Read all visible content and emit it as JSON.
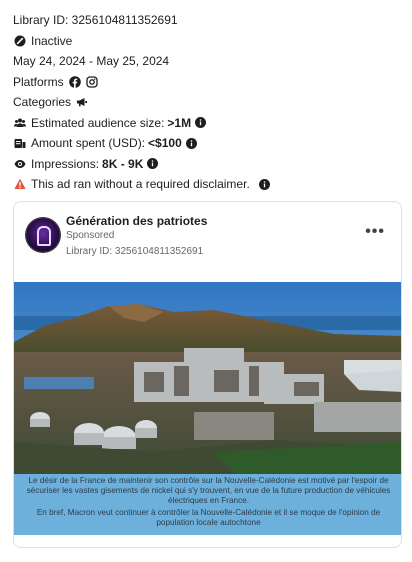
{
  "ad_meta": {
    "library_id": "Library ID: 3256104811352691",
    "status": "Inactive",
    "date_range": "May 24, 2024 - May 25, 2024",
    "platforms_label": "Platforms",
    "platform_icons": [
      "facebook-icon",
      "instagram-icon"
    ],
    "categories_label": "Categories",
    "category_icon": "megaphone-icon",
    "audience_label": "Estimated audience size:",
    "audience_value": ">1M",
    "amount_label": "Amount spent (USD):",
    "amount_value": "<$100",
    "impressions_label": "Impressions:",
    "impressions_value": "8K - 9K",
    "disclaimer": "This ad ran without a required disclaimer."
  },
  "card": {
    "page_name": "Génération des patriotes",
    "sponsored": "Sponsored",
    "library_id": "Library ID: 3256104811352691",
    "more_label": "•••"
  },
  "media": {
    "caption_p1": "Le désir de la France de maintenir son contrôle sur la Nouvelle-Calédonie est motivé par l'espoir de sécuriser les vastes gisements de nickel qui s'y trouvent, en vue de la future production de véhicules électriques en France.",
    "caption_p2": "En bref, Macron veut continuer à contrôler la Nouvelle-Calédonie et il se moque de l'opinion de  population  locale  autochtone"
  },
  "colors": {
    "warning": "#e4543c",
    "caption_bg": "#6db0dc",
    "muted_text": "#65676b"
  }
}
